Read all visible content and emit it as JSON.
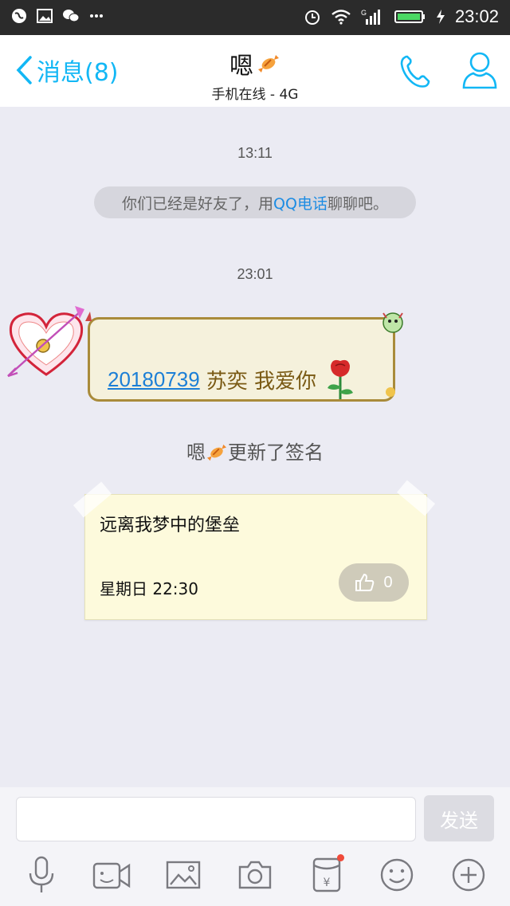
{
  "status_bar": {
    "time": "23:02",
    "signal_label": "G"
  },
  "nav": {
    "back_label": "消息(8)",
    "title": "嗯",
    "subtitle": "手机在线 - 4G"
  },
  "chat": {
    "time_1": "13:11",
    "system_message": {
      "prefix": "你们已经是好友了，用",
      "link": "QQ电话",
      "suffix": "聊聊吧。"
    },
    "time_2": "23:01",
    "message": {
      "link": "20180739",
      "text": "苏奕 我爱你"
    },
    "update_notice": {
      "name": "嗯",
      "text": "更新了签名"
    },
    "signature": {
      "text": "远离我梦中的堡垒",
      "date": "星期日 22:30",
      "likes": "0"
    }
  },
  "input": {
    "placeholder": "",
    "send_label": "发送"
  },
  "colors": {
    "accent": "#12b7f5",
    "link": "#1c8ce3",
    "background": "#ebebf3"
  }
}
